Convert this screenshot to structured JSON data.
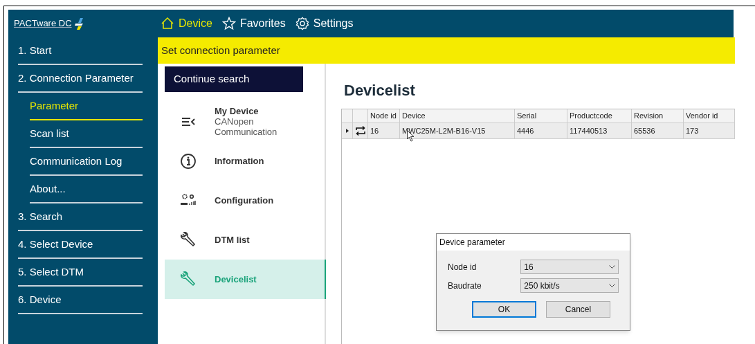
{
  "logo": {
    "text": "PACTware DC"
  },
  "top_nav": [
    {
      "label": "Device",
      "kind": "home",
      "selected": true
    },
    {
      "label": "Favorites",
      "kind": "star",
      "selected": false
    },
    {
      "label": "Settings",
      "kind": "gear",
      "selected": false
    }
  ],
  "sidebar": {
    "items": [
      {
        "label": "1. Start",
        "selected": false
      },
      {
        "label": "2. Connection Parameter",
        "selected": false,
        "children": [
          {
            "label": "Parameter",
            "selected": true
          },
          {
            "label": "Scan list",
            "selected": false
          },
          {
            "label": "Communication Log",
            "selected": false
          },
          {
            "label": "About...",
            "selected": false
          }
        ]
      },
      {
        "label": "3. Search",
        "selected": false
      },
      {
        "label": "4. Select Device",
        "selected": false
      },
      {
        "label": "5. Select DTM",
        "selected": false
      },
      {
        "label": "6. Device",
        "selected": false
      }
    ]
  },
  "banner": "Set connection parameter",
  "continue_button": "Continue search",
  "nav_list": [
    {
      "label": "My Device",
      "subtitle": "CANopen Communication",
      "kind": "menu",
      "selected": false
    },
    {
      "label": "Information",
      "kind": "info",
      "selected": false
    },
    {
      "label": "Configuration",
      "kind": "config",
      "selected": false
    },
    {
      "label": "DTM list",
      "kind": "wrench",
      "selected": false
    },
    {
      "label": "Devicelist",
      "kind": "wrench",
      "selected": true
    }
  ],
  "devicelist": {
    "title": "Devicelist",
    "table": {
      "columns": [
        "Node id",
        "Device",
        "Serial",
        "Productcode",
        "Revision",
        "Vendor id"
      ],
      "rows": [
        {
          "cells": [
            "16",
            "MWC25M-L2M-B16-V15",
            "4446",
            "117440513",
            "65536",
            "173"
          ]
        }
      ]
    }
  },
  "dialog": {
    "title": "Device parameter",
    "fields": [
      {
        "label": "Node id",
        "value": "16"
      },
      {
        "label": "Baudrate",
        "value": "250 kbit/s"
      }
    ],
    "buttons": [
      {
        "label": "OK",
        "default": true
      },
      {
        "label": "Cancel",
        "default": false
      }
    ]
  }
}
